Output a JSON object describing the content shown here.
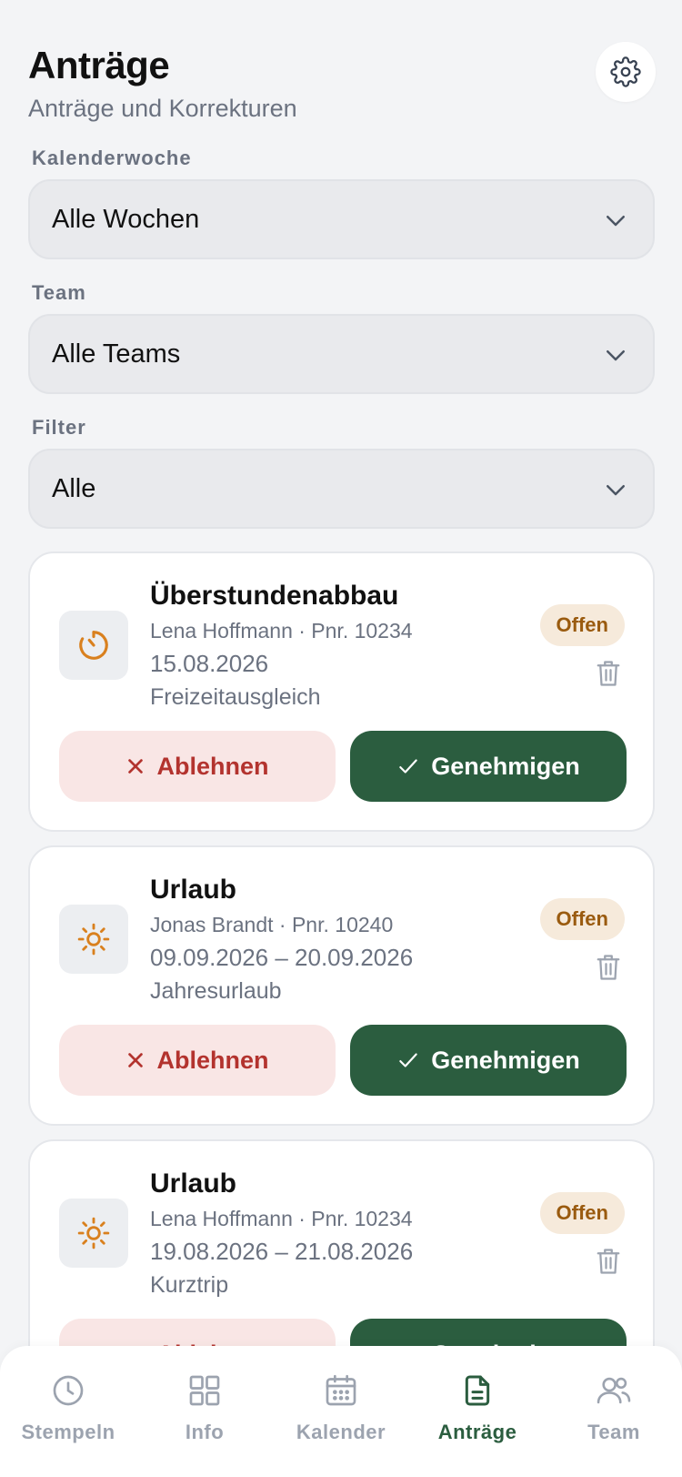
{
  "header": {
    "title": "Anträge",
    "subtitle": "Anträge und Korrekturen",
    "settings_icon": "gear-icon"
  },
  "filters": {
    "week": {
      "label": "Kalenderwoche",
      "value": "Alle Wochen"
    },
    "team": {
      "label": "Team",
      "value": "Alle Teams"
    },
    "filter": {
      "label": "Filter",
      "value": "Alle"
    }
  },
  "requests": [
    {
      "title": "Überstundenabbau",
      "meta": "Lena Hoffmann · Pnr. 10234",
      "date": "15.08.2026",
      "note": "Freizeitausgleich",
      "status": "Offen",
      "icon": "timer-icon",
      "reject_label": "Ablehnen",
      "approve_label": "Genehmigen"
    },
    {
      "title": "Urlaub",
      "meta": "Jonas Brandt · Pnr. 10240",
      "date": "09.09.2026 – 20.09.2026",
      "note": "Jahresurlaub",
      "status": "Offen",
      "icon": "sun-icon",
      "reject_label": "Ablehnen",
      "approve_label": "Genehmigen"
    },
    {
      "title": "Urlaub",
      "meta": "Lena Hoffmann · Pnr. 10234",
      "date": "19.08.2026 – 21.08.2026",
      "note": "Kurztrip",
      "status": "Offen",
      "icon": "sun-icon",
      "reject_label": "Ablehnen",
      "approve_label": "Genehmigen"
    }
  ],
  "tabs": [
    {
      "label": "Stempeln",
      "icon": "clock-icon",
      "active": false
    },
    {
      "label": "Info",
      "icon": "grid-icon",
      "active": false
    },
    {
      "label": "Kalender",
      "icon": "calendar-icon",
      "active": false
    },
    {
      "label": "Anträge",
      "icon": "document-icon",
      "active": true
    },
    {
      "label": "Team",
      "icon": "users-icon",
      "active": false
    }
  ],
  "colors": {
    "accent_green": "#2b5d3f",
    "reject_red": "#b3332e",
    "badge_bg": "#f6eadb",
    "badge_text": "#9a5b0f",
    "icon_orange": "#d9801e"
  }
}
